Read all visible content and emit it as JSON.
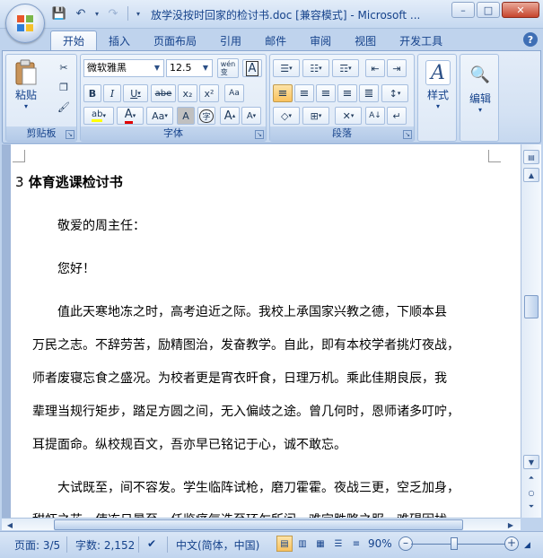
{
  "window": {
    "title": "放学没按时回家的检讨书.doc [兼容模式] - Microsoft ...",
    "min_label": "–",
    "max_label": "□",
    "close_label": "✕"
  },
  "qat": {
    "save_icon": "💾",
    "undo_icon": "↶",
    "redo_icon": "↷",
    "more_icon": "▾"
  },
  "tabs": [
    "开始",
    "插入",
    "页面布局",
    "引用",
    "邮件",
    "审阅",
    "视图",
    "开发工具"
  ],
  "help_label": "?",
  "ribbon": {
    "clipboard": {
      "label": "剪贴板",
      "paste_label": "粘贴",
      "paste_arrow": "▾",
      "cut_icon": "✂",
      "copy_icon": "❐",
      "painter_icon": "🖌"
    },
    "font": {
      "label": "字体",
      "font_name": "微软雅黑",
      "font_size": "12.5",
      "wen_label": "wén\n变",
      "A_box": "A",
      "bold": "B",
      "italic": "I",
      "underline": "U",
      "strike": "abe",
      "subscript": "x₂",
      "superscript": "x²",
      "clear_format": "Aa",
      "highlight": "ab",
      "font_color": "A",
      "change_case": "Aa",
      "char_shading": "A",
      "enclose": "字",
      "grow": "A",
      "shrink": "A"
    },
    "paragraph": {
      "label": "段落",
      "bullets": "☰",
      "numbering": "☷",
      "multilevel": "☶",
      "decrease_indent": "⇤",
      "increase_indent": "⇥",
      "align_left": "≡",
      "center": "≡",
      "align_right": "≡",
      "justify": "≡",
      "distribute": "≣",
      "line_spacing": "↕",
      "shading": "◇",
      "borders": "⊞",
      "asian_layout": "✕",
      "sort": "A↓",
      "show_marks": "↵"
    },
    "styles": {
      "label": "样式",
      "icon": "A"
    },
    "editing": {
      "label": "编辑",
      "icon": "🔍"
    }
  },
  "document": {
    "heading_number": "3",
    "heading": "体育逃课检讨书",
    "lines": [
      "敬爱的周主任：",
      "您好！",
      "值此天寒地冻之时，高考迫近之际。我校上承国家兴教之德，下顺本县",
      "万民之志。不辞劳苦，励精图治，发奋教学。自此，即有本校学者挑灯夜战，",
      "师者废寝忘食之盛况。为校者更是宵衣旰食，日理万机。乘此佳期良辰，我",
      "辈理当规行矩步，踏足方圆之间，无入偏歧之途。曾几何时，恩师诸多叮咛，",
      "耳提面命。纵校规百文，吾亦早已铭记于心，诚不敢忘。",
      "大试既至，间不容发。学生临阵试枪，磨刀霍霍。夜战三更，空乏加身，",
      "甜虾之花，使冻日暑至，任鉴痛气迭至环乍所问，难定胜略之服，难碍困扰"
    ]
  },
  "statusbar": {
    "page": "页面: 3/5",
    "words": "字数: 2,152",
    "language": "中文(简体，中国)",
    "zoom": "90%",
    "zoom_minus": "–",
    "zoom_plus": "+",
    "zoom_fraction": 0.45
  }
}
